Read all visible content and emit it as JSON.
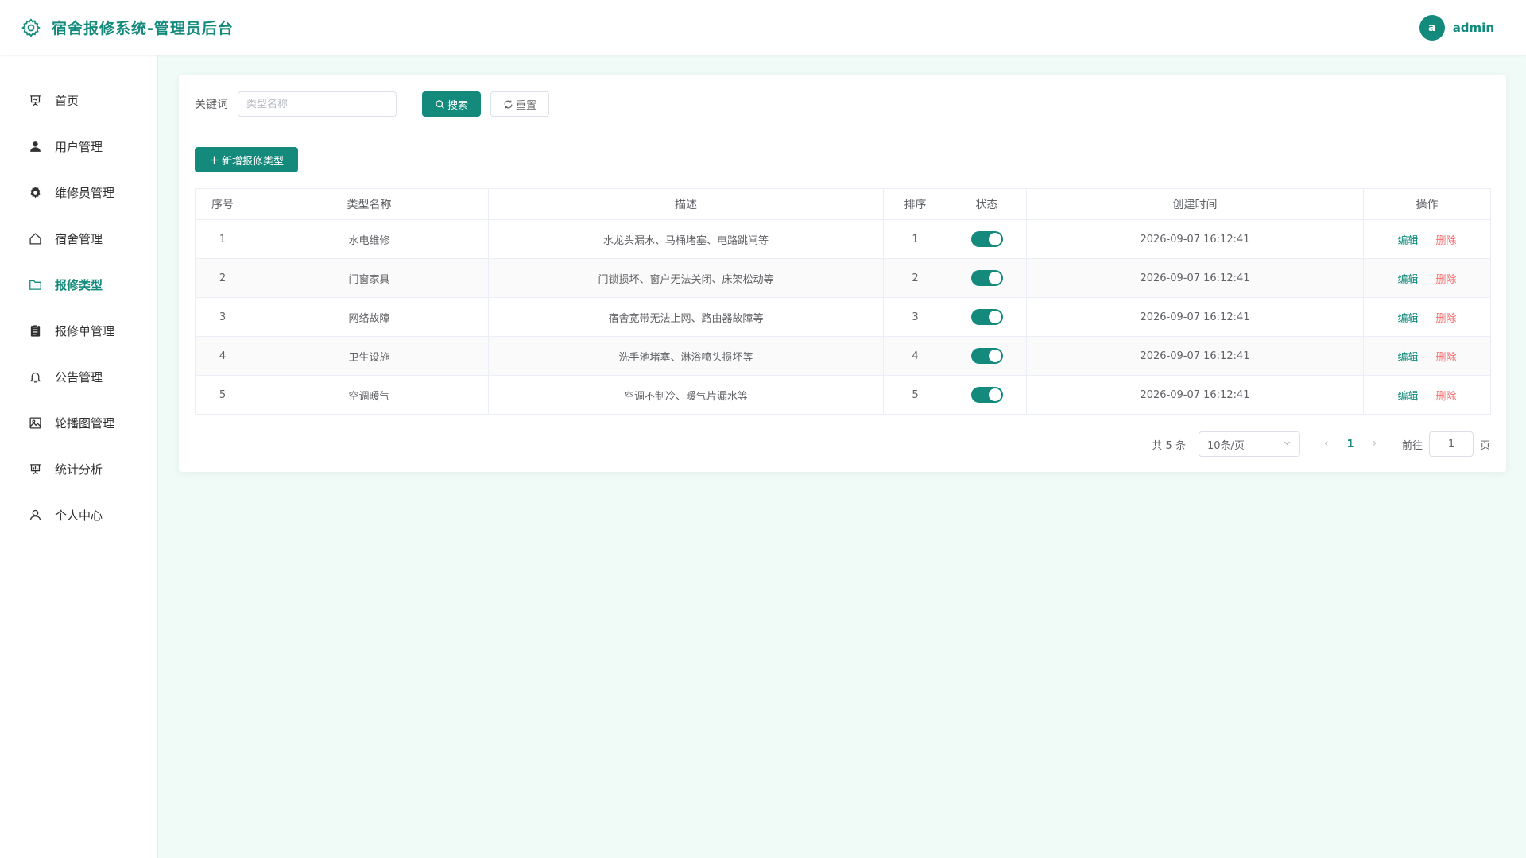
{
  "header": {
    "title": "宿舍报修系统-管理员后台",
    "avatar_letter": "a",
    "user_name": "admin"
  },
  "sidebar": {
    "items": [
      {
        "label": "首页",
        "icon": "presentation-icon"
      },
      {
        "label": "用户管理",
        "icon": "user-icon"
      },
      {
        "label": "维修员管理",
        "icon": "gear-icon"
      },
      {
        "label": "宿舍管理",
        "icon": "house-icon"
      },
      {
        "label": "报修类型",
        "icon": "folder-icon",
        "active": true
      },
      {
        "label": "报修单管理",
        "icon": "clipboard-icon"
      },
      {
        "label": "公告管理",
        "icon": "bell-icon"
      },
      {
        "label": "轮播图管理",
        "icon": "picture-icon"
      },
      {
        "label": "统计分析",
        "icon": "data-board-icon"
      },
      {
        "label": "个人中心",
        "icon": "person-icon"
      }
    ]
  },
  "filter": {
    "keyword_label": "关键词",
    "keyword_placeholder": "类型名称",
    "keyword_value": "",
    "search_label": "搜索",
    "reset_label": "重置"
  },
  "add_button_label": "新增报修类型",
  "table": {
    "columns": [
      "序号",
      "类型名称",
      "描述",
      "排序",
      "状态",
      "创建时间",
      "操作"
    ],
    "rows": [
      {
        "index": "1",
        "name": "水电维修",
        "desc": "水龙头漏水、马桶堵塞、电路跳闸等",
        "sort": "1",
        "enabled": true,
        "created": "2026-09-07 16:12:41"
      },
      {
        "index": "2",
        "name": "门窗家具",
        "desc": "门锁损坏、窗户无法关闭、床架松动等",
        "sort": "2",
        "enabled": true,
        "created": "2026-09-07 16:12:41"
      },
      {
        "index": "3",
        "name": "网络故障",
        "desc": "宿舍宽带无法上网、路由器故障等",
        "sort": "3",
        "enabled": true,
        "created": "2026-09-07 16:12:41"
      },
      {
        "index": "4",
        "name": "卫生设施",
        "desc": "洗手池堵塞、淋浴喷头损坏等",
        "sort": "4",
        "enabled": true,
        "created": "2026-09-07 16:12:41"
      },
      {
        "index": "5",
        "name": "空调暖气",
        "desc": "空调不制冷、暖气片漏水等",
        "sort": "5",
        "enabled": true,
        "created": "2026-09-07 16:12:41"
      }
    ],
    "edit_label": "编辑",
    "delete_label": "删除"
  },
  "pagination": {
    "total_text": "共 5 条",
    "page_size": "10条/页",
    "current_page": "1",
    "goto_label": "前往",
    "goto_value": "1",
    "page_unit": "页"
  },
  "colors": {
    "accent": "#138a7b",
    "danger": "#f56c6c",
    "background": "#f0fbf8"
  }
}
